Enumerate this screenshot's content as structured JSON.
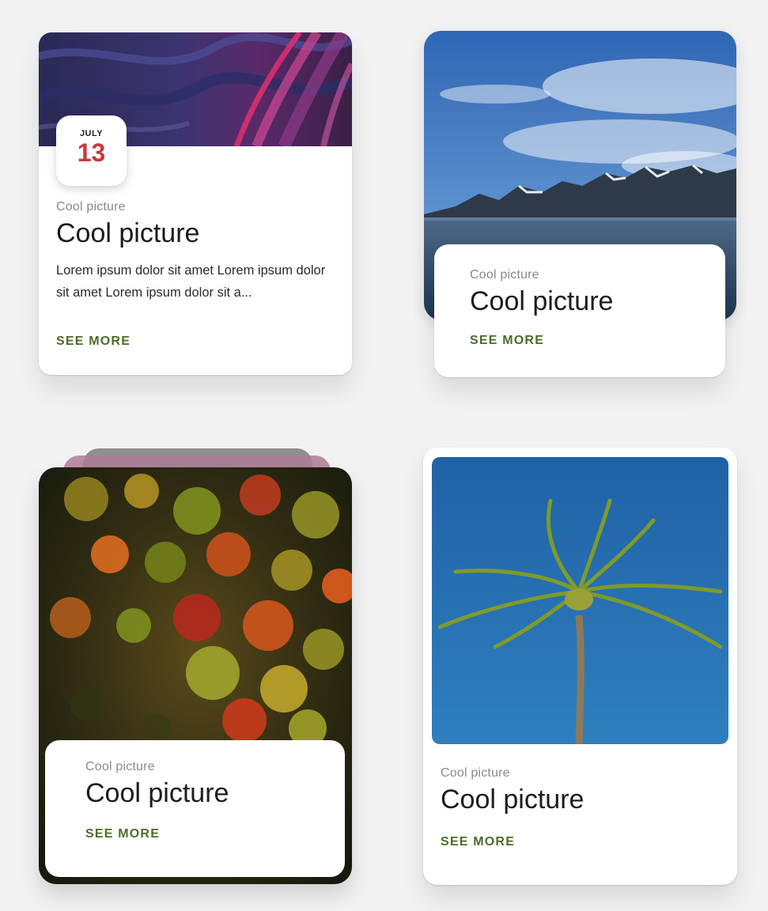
{
  "colors": {
    "background": "#f2f2f2",
    "accent_green": "#4e6b2a",
    "date_red": "#c8393b",
    "subtitle_gray": "#8a8a8a"
  },
  "cards": [
    {
      "image": "abstract-marble-purple-pink",
      "date": {
        "month": "JULY",
        "day": "13"
      },
      "subtitle": "Cool picture",
      "title": "Cool picture",
      "description": "Lorem ipsum dolor sit amet Lorem ipsum dolor sit amet Lorem ipsum dolor sit a...",
      "action": "SEE MORE"
    },
    {
      "image": "mountain-lake-blue-sky",
      "subtitle": "Cool picture",
      "title": "Cool picture",
      "action": "SEE MORE"
    },
    {
      "image": "autumn-maple-leaves",
      "subtitle": "Cool picture",
      "title": "Cool picture",
      "action": "SEE MORE"
    },
    {
      "image": "palm-tree-blue-sky",
      "subtitle": "Cool picture",
      "title": "Cool picture",
      "action": "SEE MORE"
    }
  ]
}
